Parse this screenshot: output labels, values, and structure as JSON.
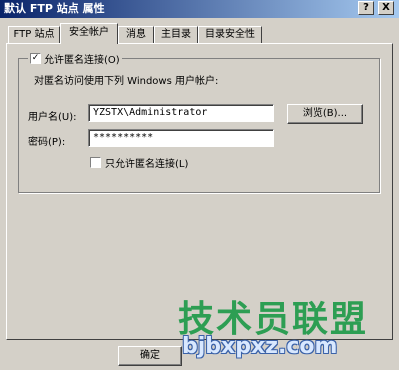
{
  "window": {
    "title": "默认 FTP 站点 属性",
    "help_btn": "?",
    "close_btn": "X"
  },
  "tabs": [
    {
      "label": "FTP 站点",
      "active": false
    },
    {
      "label": "安全帐户",
      "active": true
    },
    {
      "label": "消息",
      "active": false
    },
    {
      "label": "主目录",
      "active": false
    },
    {
      "label": "目录安全性",
      "active": false
    }
  ],
  "anon": {
    "allow_label": "允许匿名连接(O)",
    "allow_checked": true,
    "description": "对匿名访问使用下列 Windows 用户帐户:",
    "username_label": "用户名(U):",
    "username_value": "YZSTX\\Administrator",
    "browse_label": "浏览(B)...",
    "password_label": "密码(P):",
    "password_value": "**********",
    "only_anon_label": "只允许匿名连接(L)",
    "only_anon_checked": false
  },
  "footer": {
    "ok_label": "确定"
  },
  "watermark": {
    "cn": "技术员联盟",
    "url": "bjbxpxz.com"
  },
  "colors": {
    "titlebar_start": "#0a246a",
    "face": "#d4d0c8",
    "watermark_green": "#1f9a4a"
  }
}
